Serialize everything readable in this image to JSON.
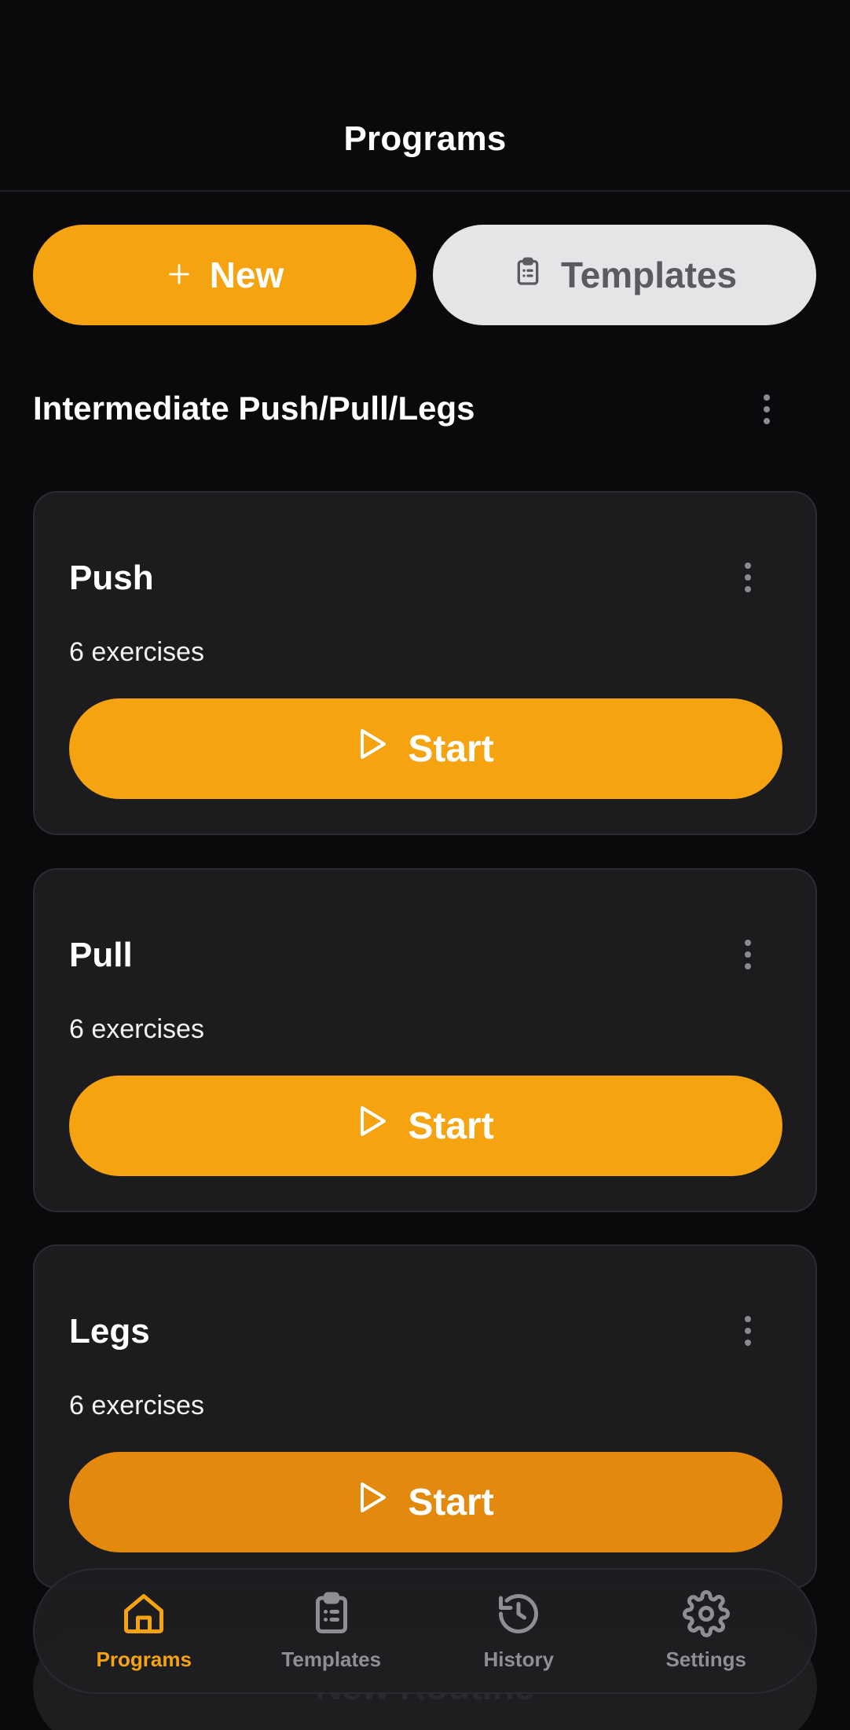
{
  "header": {
    "title": "Programs"
  },
  "actions": {
    "new_label": "New",
    "templates_label": "Templates"
  },
  "program": {
    "title": "Intermediate Push/Pull/Legs",
    "routines": [
      {
        "name": "Push",
        "subtitle": "6 exercises",
        "start_label": "Start"
      },
      {
        "name": "Pull",
        "subtitle": "6 exercises",
        "start_label": "Start"
      },
      {
        "name": "Legs",
        "subtitle": "6 exercises",
        "start_label": "Start"
      }
    ]
  },
  "ghost_button": {
    "label": "New Routine"
  },
  "nav": {
    "items": [
      {
        "label": "Programs",
        "icon": "home-icon",
        "active": true
      },
      {
        "label": "Templates",
        "icon": "clipboard-icon",
        "active": false
      },
      {
        "label": "History",
        "icon": "history-icon",
        "active": false
      },
      {
        "label": "Settings",
        "icon": "gear-icon",
        "active": false
      }
    ]
  },
  "colors": {
    "accent": "#f5a310",
    "background": "#0a0a0c",
    "card": "#1c1c1f",
    "inactive": "#8e8e94"
  }
}
